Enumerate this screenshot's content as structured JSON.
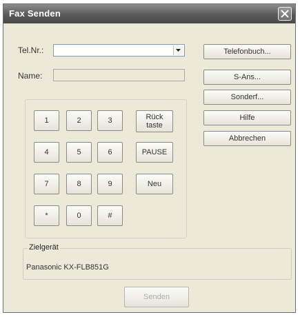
{
  "window": {
    "title": "Fax Senden"
  },
  "fields": {
    "tel_label": "Tel.Nr.:",
    "tel_value": "",
    "name_label": "Name:",
    "name_value": ""
  },
  "keypad": {
    "k1": "1",
    "k2": "2",
    "k3": "3",
    "k4": "4",
    "k5": "5",
    "k6": "6",
    "k7": "7",
    "k8": "8",
    "k9": "9",
    "kstar": "*",
    "k0": "0",
    "khash": "#",
    "backspace_line1": "Rück",
    "backspace_line2": "taste",
    "pause": "PAUSE",
    "new": "Neu"
  },
  "side_buttons": {
    "phonebook": "Telefonbuch...",
    "sans": "S-Ans...",
    "special": "Sonderf...",
    "help": "Hilfe",
    "cancel": "Abbrechen"
  },
  "target_device": {
    "label": "Zielgerät",
    "value": "Panasonic KX-FLB851G"
  },
  "send_button": "Senden",
  "icons": {
    "close": "close-icon",
    "dropdown": "chevron-down-icon"
  }
}
